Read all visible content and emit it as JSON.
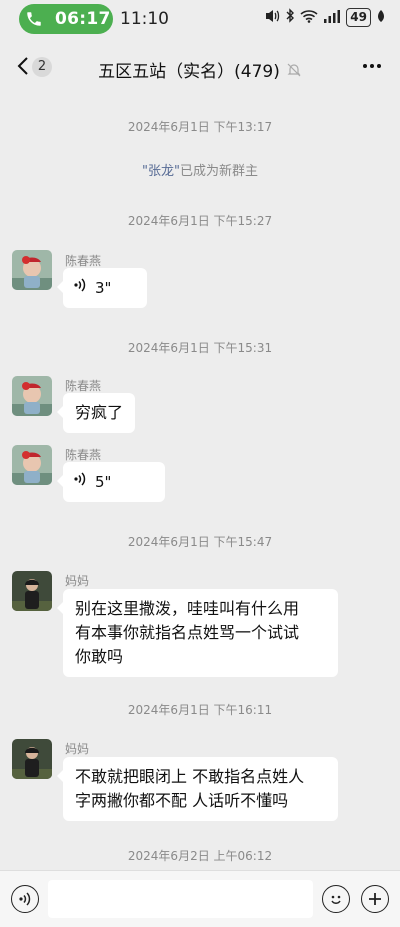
{
  "status_bar": {
    "call_timer": "06:17",
    "clock": "11:10",
    "battery": "49"
  },
  "header": {
    "back_count": "2",
    "title": "五区五站（实名）(479)"
  },
  "messages": {
    "ts1": "2024年6月1日 下午13:17",
    "sys_name": "\"张龙\"",
    "sys_text": "已成为新群主",
    "ts2": "2024年6月1日 下午15:27",
    "m1_sender": "陈春燕",
    "m1_voice": "3\"",
    "ts3": "2024年6月1日 下午15:31",
    "m2_sender": "陈春燕",
    "m2_text": "穷疯了",
    "m3_sender": "陈春燕",
    "m3_voice": "5\"",
    "ts4": "2024年6月1日 下午15:47",
    "m4_sender": "妈妈",
    "m4_line1": "别在这里撒泼，哇哇叫有什么用",
    "m4_line2": "有本事你就指名点姓骂一个试试",
    "m4_line3": "你敢吗",
    "ts5": "2024年6月1日 下午16:11",
    "m5_sender": "妈妈",
    "m5_line1": "不敢就把眼闭上 不敢指名点姓人",
    "m5_line2": "字两撇你都不配 人话听不懂吗",
    "ts6": "2024年6月2日 上午06:12"
  },
  "colors": {
    "background": "#ededed",
    "call_green": "#4caf50",
    "link_blue": "#576b95",
    "bubble": "#ffffff"
  },
  "icons": {
    "phone": "phone-icon",
    "back": "chevron-left-icon",
    "mute": "bell-off-icon",
    "more": "more-dots-icon",
    "voice": "voice-wave-icon",
    "emoji": "emoji-icon",
    "plus": "plus-icon"
  }
}
